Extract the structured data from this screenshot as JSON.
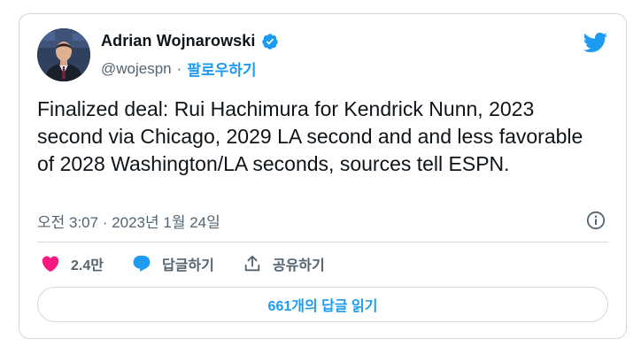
{
  "author": {
    "name": "Adrian Wojnarowski",
    "handle": "@wojespn",
    "separator": "·",
    "follow_label": "팔로우하기"
  },
  "tweet": {
    "text": "Finalized deal: Rui Hachimura for Kendrick Nunn, 2023 second via Chicago, 2029 LA second and and less favorable of 2028 Washington/LA seconds, sources tell ESPN.",
    "timestamp": "오전 3:07 · 2023년 1월 24일"
  },
  "actions": {
    "like_count": "2.4만",
    "reply_label": "답글하기",
    "share_label": "공유하기"
  },
  "replies_button": {
    "label": "661개의 답글 읽기"
  },
  "colors": {
    "accent": "#1d9bf0",
    "like": "#f91880",
    "text": "#0f1419",
    "muted": "#536471",
    "border": "#cfd9de"
  },
  "icons": [
    "twitter-bird-icon",
    "verified-badge-icon",
    "info-icon",
    "heart-icon",
    "reply-bubble-icon",
    "share-icon"
  ]
}
